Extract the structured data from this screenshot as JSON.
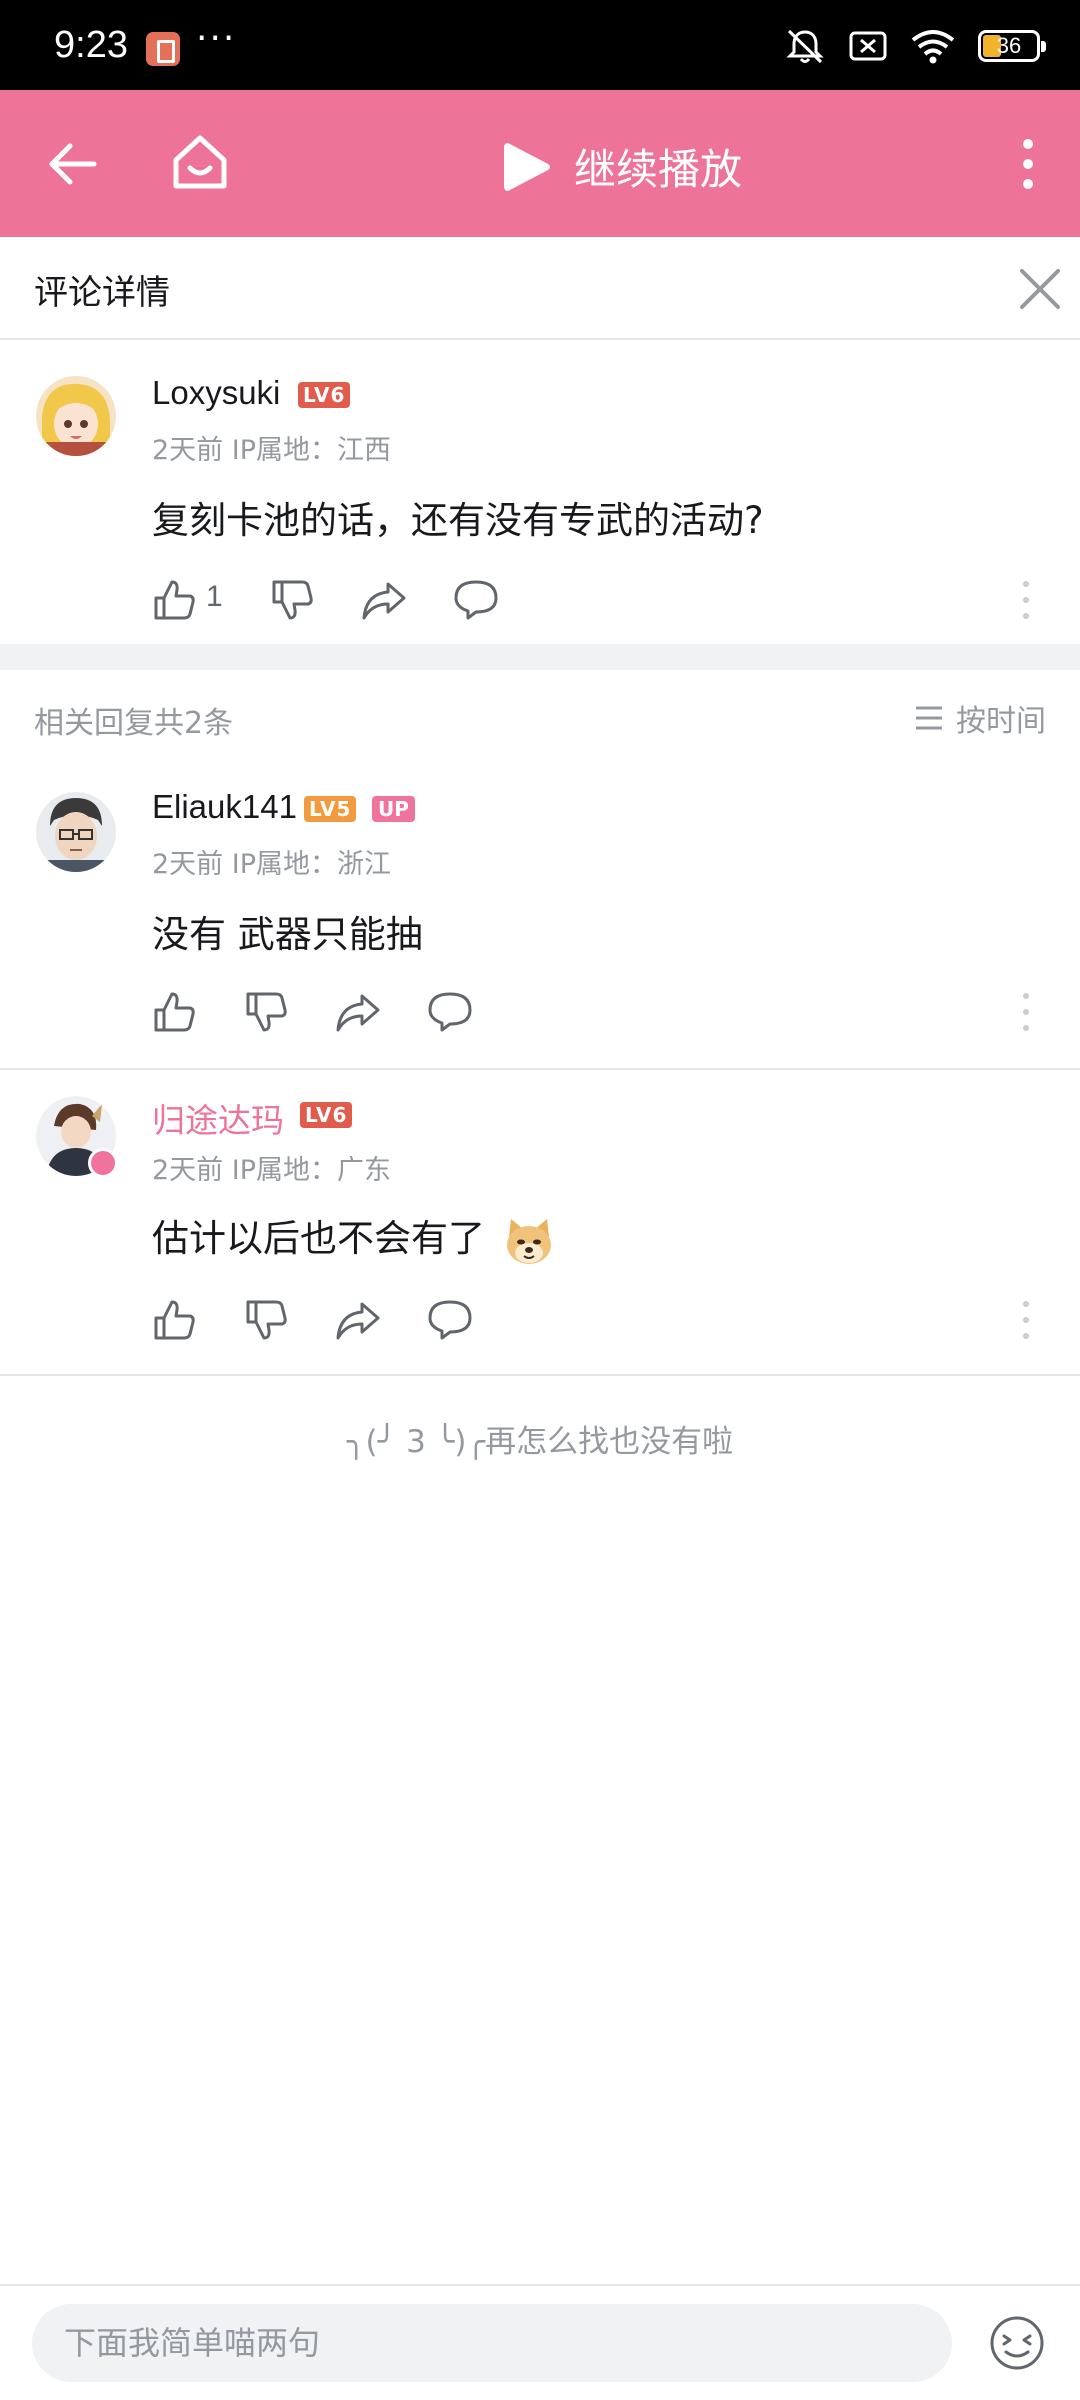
{
  "status_bar": {
    "time": "9:23",
    "dots": "···",
    "battery": "36"
  },
  "app_bar": {
    "play_label": "继续播放"
  },
  "detail": {
    "title": "评论详情"
  },
  "root_comment": {
    "username": "Loxysuki",
    "level": "LV6",
    "meta": "2天前 IP属地：江西",
    "text": "复刻卡池的话，还有没有专武的活动?",
    "like_count": "1"
  },
  "replies": {
    "count_label": "相关回复共2条",
    "sort_label": "按时间",
    "items": [
      {
        "username": "Eliauk141",
        "level": "LV5",
        "badge": "UP",
        "meta": "2天前 IP属地：浙江",
        "text": "没有 武器只能抽"
      },
      {
        "username": "归途达玛",
        "level": "LV6",
        "meta": "2天前 IP属地：广东",
        "text": "估计以后也不会有了"
      }
    ]
  },
  "end_text": "╮(╯ 3 ╰)╭再怎么找也没有啦",
  "bottom": {
    "input_placeholder": "下面我简单喵两句"
  },
  "colors": {
    "accent": "#ee7399",
    "lv6": "#e25c4e",
    "lv5": "#f29b3e",
    "up_badge": "#f0739e"
  }
}
